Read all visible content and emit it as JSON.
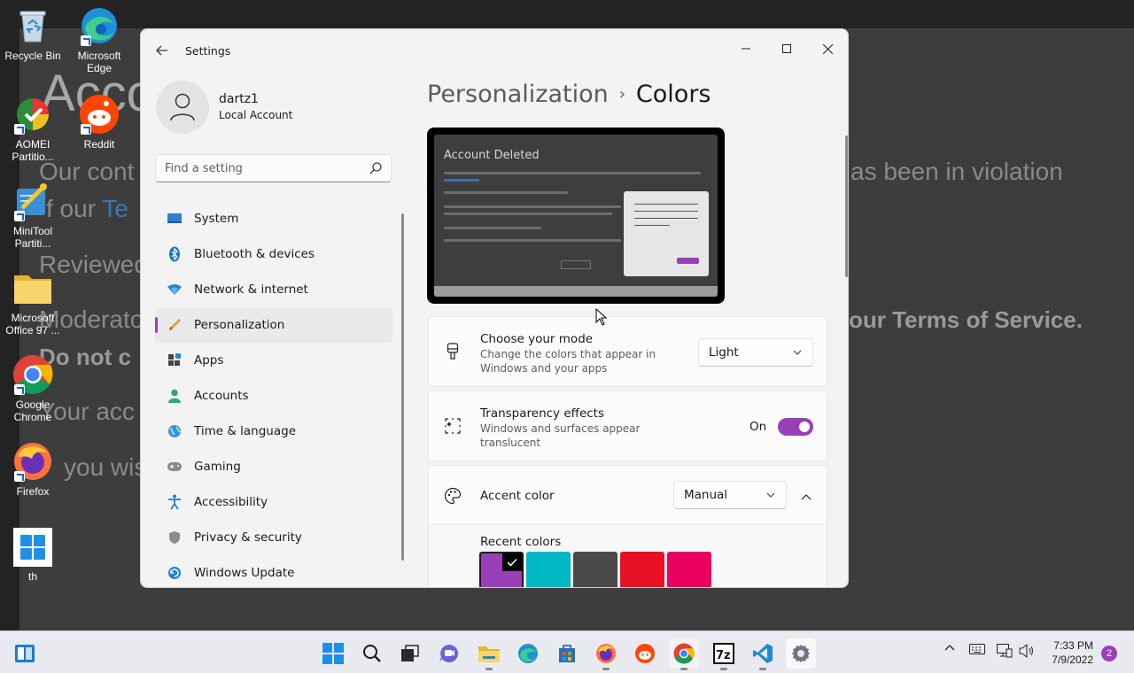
{
  "wallpaper": {
    "heading": "Acco",
    "line1_left": "Our cont",
    "line1_right": "as been in violation",
    "line2_prefix": "f our ",
    "line2_link": "Te",
    "reviewed": "Reviewed",
    "moderator": "Moderato",
    "moderator_right": "our Terms of Service.",
    "do_not": "Do not c",
    "your_acc": "Your acc",
    "if_you": "you wis"
  },
  "desktop": {
    "icons": [
      {
        "label": "Recycle Bin",
        "icon": "recycle-bin-icon"
      },
      {
        "label": "Microsoft Edge",
        "icon": "edge-icon"
      },
      {
        "label": "AOMEI Partitio...",
        "icon": "aomei-icon"
      },
      {
        "label": "Reddit",
        "icon": "reddit-icon"
      },
      {
        "label": "MiniTool Partiti...",
        "icon": "minitool-icon"
      },
      {
        "label": "Microsoft Office 97 ...",
        "icon": "folder-icon"
      },
      {
        "label": "Google Chrome",
        "icon": "chrome-icon"
      },
      {
        "label": "Firefox",
        "icon": "firefox-icon"
      },
      {
        "label": "th",
        "icon": "windows-logo-icon"
      }
    ]
  },
  "window": {
    "title": "Settings",
    "user_name": "dartz1",
    "user_type": "Local Account",
    "search_placeholder": "Find a setting"
  },
  "nav": {
    "items": [
      {
        "label": "System",
        "icon": "system-icon"
      },
      {
        "label": "Bluetooth & devices",
        "icon": "bluetooth-icon"
      },
      {
        "label": "Network & internet",
        "icon": "wifi-icon"
      },
      {
        "label": "Personalization",
        "icon": "brush-icon",
        "active": true
      },
      {
        "label": "Apps",
        "icon": "apps-icon"
      },
      {
        "label": "Accounts",
        "icon": "accounts-icon"
      },
      {
        "label": "Time & language",
        "icon": "globe-icon"
      },
      {
        "label": "Gaming",
        "icon": "gamepad-icon"
      },
      {
        "label": "Accessibility",
        "icon": "accessibility-icon"
      },
      {
        "label": "Privacy & security",
        "icon": "shield-icon"
      },
      {
        "label": "Windows Update",
        "icon": "update-icon"
      }
    ]
  },
  "content": {
    "breadcrumb_parent": "Personalization",
    "breadcrumb_sep": "›",
    "breadcrumb_current": "Colors",
    "preview_title": "Account Deleted",
    "mode": {
      "title": "Choose your mode",
      "desc_line1": "Change the colors that appear in",
      "desc_line2": "Windows and your apps",
      "value": "Light"
    },
    "transparency": {
      "title": "Transparency effects",
      "desc_line1": "Windows and surfaces appear",
      "desc_line2": "translucent",
      "state_label": "On",
      "enabled": true
    },
    "accent": {
      "title": "Accent color",
      "value": "Manual",
      "recent_label": "Recent colors",
      "recent_colors": [
        "#9a3fb8",
        "#00b7c3",
        "#4c4a48",
        "#e81123",
        "#ea005e"
      ],
      "selected_index": 0
    }
  },
  "colors": {
    "accent": "#9a3fb8"
  },
  "taskbar": {
    "apps": [
      "start-icon",
      "search-icon",
      "task-view-icon",
      "chat-icon",
      "file-explorer-icon",
      "edge-icon",
      "store-icon",
      "firefox-icon",
      "reddit-icon",
      "chrome-icon",
      "7zip-icon",
      "vscode-icon",
      "settings-icon"
    ],
    "time": "7:33 PM",
    "date": "7/9/2022",
    "notification_count": "2"
  }
}
